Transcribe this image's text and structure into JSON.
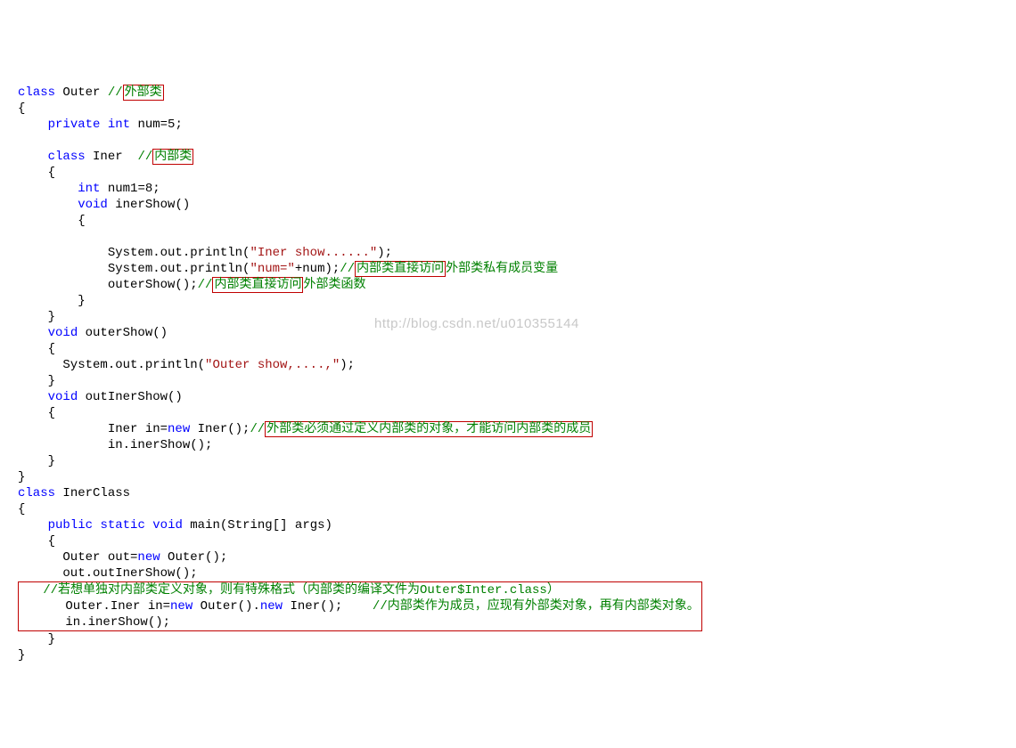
{
  "code": {
    "l01_kw_class": "class",
    "l01_name": "Outer",
    "l01_cmt_slash": "//",
    "l01_cmt_box": "外部类",
    "l02": "{",
    "l03_kw_private": "private",
    "l03_kw_int": "int",
    "l03_rest": " num=5;",
    "l04": "",
    "l05_kw_class": "class",
    "l05_name": "Iner ",
    "l05_cmt_slash": " //",
    "l05_cmt_box": "内部类",
    "l06": "    {",
    "l07_kw_int": "int",
    "l07_rest": " num1=8;",
    "l08_kw_void": "void",
    "l08_rest": " inerShow()",
    "l09": "        {",
    "l10": "",
    "l11_pre": "            System.out.println(",
    "l11_str": "\"Iner show......\"",
    "l11_post": ");",
    "l12_pre": "            System.out.println(",
    "l12_str": "\"num=\"",
    "l12_post": "+num);",
    "l12_cslash": "//",
    "l12_cbox": "内部类直接访问",
    "l12_ctail": "外部类私有成员变量",
    "l13_pre": "            outerShow();",
    "l13_cslash": "//",
    "l13_cbox": "内部类直接访问",
    "l13_ctail": "外部类函数",
    "l14": "        }",
    "l15": "    }",
    "l16_kw_void": "void",
    "l16_rest": " outerShow()",
    "l17": "    {",
    "l18_pre": "      System.out.println(",
    "l18_str": "\"Outer show,....,\"",
    "l18_post": ");",
    "l19": "    }",
    "l20_kw_void": "void",
    "l20_rest": " outInerShow()",
    "l21": "    {",
    "l22_pre": "            Iner in=",
    "l22_kw_new": "new",
    "l22_post": " Iner();",
    "l22_cslash": "//",
    "l22_cbox": "外部类必须通过定义内部类的对象，才能访问内部类的成员",
    "l23": "            in.inerShow();",
    "l24": "    }",
    "l25": "}",
    "l26_kw_class": "class",
    "l26_name": " InerClass",
    "l27": "{",
    "l28_kw_public": "public",
    "l28_kw_static": "static",
    "l28_kw_void": "void",
    "l28_mid": " main(",
    "l28_string": "String",
    "l28_post": "[] args)",
    "l29": "    {",
    "l30_pre": "      Outer out=",
    "l30_kw_new": "new",
    "l30_post": " Outer();",
    "l31": "      out.outInerShow();",
    "l32_c1": "   //若想单独对内部类定义对象，则有特殊格式（内部类的编译文件为Outer$Inter.class）",
    "l33_pre": "      Outer.Iner in=",
    "l33_kw_new1": "new",
    "l33_mid": " Outer().",
    "l33_kw_new2": "new",
    "l33_post": " Iner();",
    "l33_c": "    //内部类作为成员，应现有外部类对象，再有内部类对象。",
    "l34": "      in.inerShow();",
    "l35": "    }",
    "l36": "}"
  },
  "watermark": "http://blog.csdn.net/u010355144"
}
